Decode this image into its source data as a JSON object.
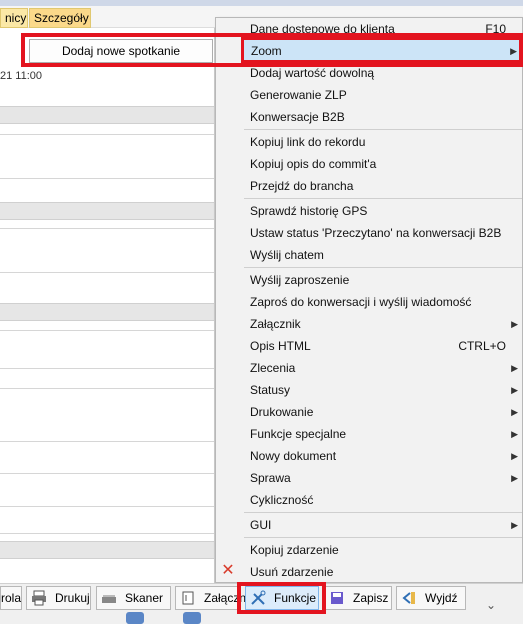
{
  "tabs": {
    "t1": "nicy",
    "t2": "Szczegóły"
  },
  "left": {
    "meeting_button": "Dodaj nowe spotkanie",
    "datetime": "21 11:00"
  },
  "menu": {
    "items": [
      {
        "label": "Dane dostepowe do klienta",
        "shortcut": "F10"
      },
      {
        "label": "Zoom",
        "submenu": true,
        "highlighted": true
      },
      {
        "label": "Dodaj wartość dowolną"
      },
      {
        "label": "Generowanie ZLP"
      },
      {
        "label": "Konwersacje B2B"
      },
      {
        "label": "Kopiuj link do rekordu"
      },
      {
        "label": "Kopiuj opis do commit'a"
      },
      {
        "label": "Przejdź do brancha"
      },
      {
        "label": "Sprawdź historię GPS"
      },
      {
        "label": "Ustaw status 'Przeczytano' na konwersacji B2B"
      },
      {
        "label": "Wyślij chatem"
      },
      {
        "label": "Wyślij zaproszenie"
      },
      {
        "label": "Zaproś do konwersacji i wyślij wiadomość"
      },
      {
        "label": "Załącznik",
        "submenu": true
      },
      {
        "label": "Opis HTML",
        "shortcut": "CTRL+O"
      },
      {
        "label": "Zlecenia",
        "submenu": true
      },
      {
        "label": "Statusy",
        "submenu": true
      },
      {
        "label": "Drukowanie",
        "submenu": true
      },
      {
        "label": "Funkcje specjalne",
        "submenu": true
      },
      {
        "label": "Nowy dokument",
        "submenu": true
      },
      {
        "label": "Sprawa",
        "submenu": true
      },
      {
        "label": "Cykliczność"
      },
      {
        "label": "GUI",
        "submenu": true
      },
      {
        "label": "Kopiuj zdarzenie"
      },
      {
        "label": "Usuń zdarzenie"
      }
    ]
  },
  "toolbar": {
    "rola": "rola",
    "drukuj": "Drukuj",
    "skaner": "Skaner",
    "zalacznik": "Załącznik",
    "funkcje": "Funkcje",
    "zapisz": "Zapisz",
    "wyjdz": "Wyjdź"
  },
  "colors": {
    "highlight": "#cce4f7",
    "annotation_red": "#e3141f"
  }
}
